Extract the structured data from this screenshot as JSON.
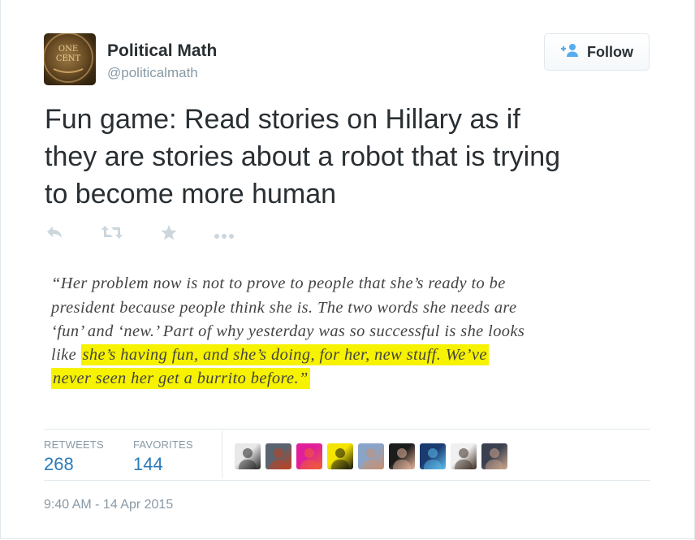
{
  "user": {
    "name": "Political Math",
    "handle": "@politicalmath",
    "avatar_text": [
      "ONE",
      "CENT"
    ]
  },
  "follow_button": {
    "label": "Follow",
    "icon": "add-user-icon"
  },
  "tweet": {
    "text_lines": [
      "Fun game: Read stories on Hillary as if",
      "they are stories about a robot that is trying",
      "to become more human"
    ]
  },
  "actions": [
    {
      "name": "reply",
      "icon": "reply-icon"
    },
    {
      "name": "retweet",
      "icon": "retweet-icon"
    },
    {
      "name": "favorite",
      "icon": "star-icon"
    },
    {
      "name": "more",
      "icon": "more-dots-icon"
    }
  ],
  "quote": {
    "line1": "“Her problem now is not to prove to people that she’s ready to be",
    "line2": "president because people think she is. The two words she needs are",
    "line3": "‘fun’ and ‘new.’ Part of why yesterday was so successful is she looks",
    "line4_plain": "like ",
    "line4_highlight": "she’s having fun, and she’s doing, for her, new stuff. We’ve",
    "line5_highlight": "never seen her get a burrito before.”",
    "highlight_color": "#f6f200"
  },
  "stats": {
    "retweets_label": "RETWEETS",
    "retweets_value": "268",
    "favorites_label": "FAVORITES",
    "favorites_value": "144"
  },
  "favoriters": [
    {
      "name": "favoriter-1",
      "colors": [
        "#e8e8e8",
        "#222222"
      ]
    },
    {
      "name": "favoriter-2",
      "colors": [
        "#5a6470",
        "#c04020"
      ]
    },
    {
      "name": "favoriter-3",
      "colors": [
        "#e0209a",
        "#f06030"
      ]
    },
    {
      "name": "favoriter-4",
      "colors": [
        "#f4e400",
        "#111111"
      ]
    },
    {
      "name": "favoriter-5",
      "colors": [
        "#8aa4c8",
        "#c89070"
      ]
    },
    {
      "name": "favoriter-6",
      "colors": [
        "#1c1c1c",
        "#e8b8a0"
      ]
    },
    {
      "name": "favoriter-7",
      "colors": [
        "#1a3a70",
        "#60c0f0"
      ]
    },
    {
      "name": "favoriter-8",
      "colors": [
        "#f0f0f0",
        "#3a2a20"
      ]
    },
    {
      "name": "favoriter-9",
      "colors": [
        "#3a4050",
        "#d0a890"
      ]
    }
  ],
  "timestamp": "9:40 AM - 14 Apr 2015",
  "colors": {
    "link": "#2b7bb9",
    "muted": "#8899a6",
    "text": "#292f33"
  }
}
